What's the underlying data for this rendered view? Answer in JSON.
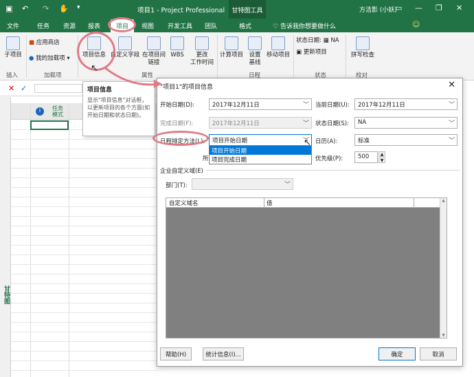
{
  "window": {
    "title": "项目1 - Project Professional",
    "context_tab": "甘特图工具",
    "user": "方洁影 (小妖)"
  },
  "tabs": [
    "文件",
    "任务",
    "资源",
    "报表",
    "项目",
    "视图",
    "开发工具",
    "团队",
    "格式"
  ],
  "tell_me": "告诉我你想要做什么",
  "ribbon": {
    "subproject": "子项目",
    "app_store": "应用商店",
    "my_addins": "我的加载项",
    "project_info": "项目信息",
    "custom_fields": "自定义字段",
    "links": "在项目间\n链接",
    "wbs": "WBS",
    "change_worktime": "更改\n工作时间",
    "calc_project": "计算项目",
    "set_baseline": "设置\n基线",
    "move_project": "移动项目",
    "status_date_label": "状态日期:",
    "status_date_value": "NA",
    "update_project": "更新项目",
    "spell_check": "拼写检查",
    "groups": [
      "插入",
      "加载项",
      "属性",
      "日程",
      "状态",
      "校对"
    ]
  },
  "tooltip": {
    "title": "项目信息",
    "body": "显示\"项目信息\"对话框，以更新项目的各个方面(如开始日期和状态日期)。"
  },
  "sheet": {
    "col_mode": "任务模式",
    "side_label": "甘特图"
  },
  "dialog": {
    "title": "\"项目1\"的项目信息",
    "start_date_label": "开始日期(D):",
    "start_date": "2017年12月11日",
    "current_date_label": "当前日期(U):",
    "current_date": "2017年12月11日",
    "finish_date_label": "完成日期(F):",
    "finish_date": "2017年12月11日",
    "status_date_label": "状态日期(S):",
    "status_date": "NA",
    "schedule_from_label": "日程排定方法(L):",
    "schedule_from": "项目开始日期",
    "schedule_options": [
      "项目开始日期",
      "项目完成日期"
    ],
    "calendar_label": "日历(A):",
    "calendar": "标准",
    "priority_label": "优先级(P):",
    "priority": "500",
    "all_label": "所",
    "enterprise_label": "企业自定义域(E)",
    "department_label": "部门(T):",
    "grid_headers": [
      "自定义域名",
      "值"
    ],
    "help_btn": "帮助(H)",
    "stats_btn": "统计信息(I)...",
    "ok_btn": "确定",
    "cancel_btn": "取消"
  }
}
